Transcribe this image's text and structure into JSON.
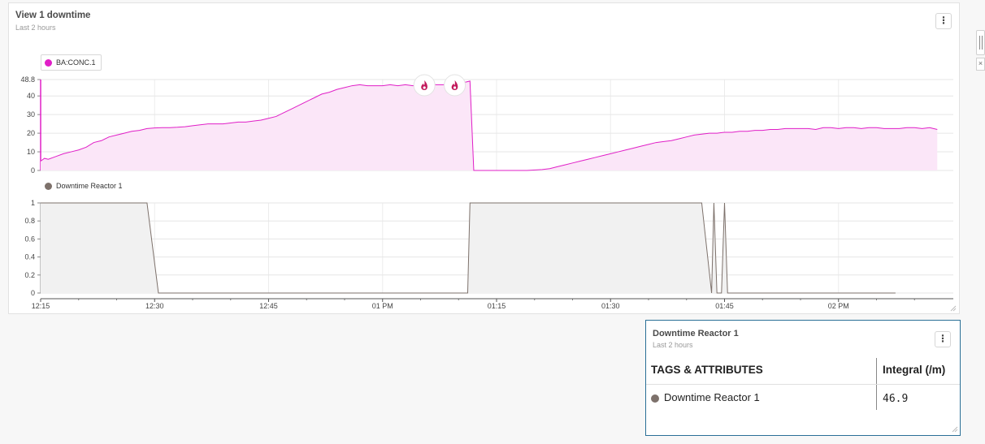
{
  "main_panel": {
    "title": "View 1 downtime",
    "subtitle": "Last 2 hours",
    "menu_glyph": "⋮"
  },
  "table_panel": {
    "title": "Downtime Reactor 1",
    "subtitle": "Last 2 hours",
    "menu_glyph": "⋮",
    "columns": [
      "TAGS & ATTRIBUTES",
      "Integral (/m)"
    ],
    "rows": [
      {
        "name": "Downtime Reactor 1",
        "value": "46.9",
        "color": "#7d716b"
      }
    ]
  },
  "close_glyph": "×",
  "chart_data": [
    {
      "type": "area",
      "series": [
        {
          "name": "BA:CONC.1",
          "color": "#e01fc7"
        }
      ],
      "ylim": [
        0,
        48.8
      ],
      "y_ticks": [
        "0",
        "10",
        "20",
        "30",
        "40",
        "48.8"
      ],
      "x_ticks": [
        "12:15",
        "12:30",
        "12:45",
        "01 PM",
        "01:15",
        "01:30",
        "01:45",
        "02 PM"
      ],
      "x_tick_minutes": [
        0,
        15,
        30,
        45,
        60,
        75,
        90,
        105
      ],
      "points": [
        [
          0,
          5
        ],
        [
          0.5,
          6.5
        ],
        [
          1,
          6
        ],
        [
          2,
          7.5
        ],
        [
          3,
          9
        ],
        [
          4,
          10
        ],
        [
          5,
          11
        ],
        [
          6,
          12.5
        ],
        [
          7,
          15
        ],
        [
          8,
          16
        ],
        [
          9,
          18
        ],
        [
          10,
          19
        ],
        [
          11,
          20
        ],
        [
          12,
          21
        ],
        [
          13,
          21.5
        ],
        [
          14,
          22.5
        ],
        [
          15,
          22.8
        ],
        [
          16,
          23
        ],
        [
          17,
          23
        ],
        [
          18,
          23.2
        ],
        [
          19,
          23.5
        ],
        [
          20,
          24
        ],
        [
          21,
          24.5
        ],
        [
          22,
          25
        ],
        [
          23,
          25
        ],
        [
          24,
          25
        ],
        [
          25,
          25.5
        ],
        [
          26,
          26
        ],
        [
          27,
          26
        ],
        [
          28,
          26.5
        ],
        [
          29,
          27
        ],
        [
          30,
          28
        ],
        [
          31,
          29
        ],
        [
          32,
          31
        ],
        [
          33,
          33
        ],
        [
          34,
          35
        ],
        [
          35,
          37
        ],
        [
          36,
          39
        ],
        [
          37,
          41
        ],
        [
          38,
          42
        ],
        [
          39,
          43.5
        ],
        [
          40,
          44.5
        ],
        [
          41,
          45.5
        ],
        [
          42,
          46
        ],
        [
          43,
          45.5
        ],
        [
          44,
          45.5
        ],
        [
          45,
          45.5
        ],
        [
          46,
          46
        ],
        [
          47,
          45.5
        ],
        [
          48,
          46
        ],
        [
          49,
          45.5
        ],
        [
          50,
          46
        ],
        [
          51,
          46.5
        ],
        [
          52,
          46
        ],
        [
          53,
          46
        ],
        [
          54,
          47
        ],
        [
          55,
          47
        ],
        [
          56,
          47.5
        ],
        [
          56.5,
          48
        ],
        [
          57,
          0
        ],
        [
          62,
          0
        ],
        [
          64,
          0
        ],
        [
          66,
          0.5
        ],
        [
          67,
          1
        ],
        [
          68,
          2
        ],
        [
          69,
          3
        ],
        [
          70,
          4
        ],
        [
          71,
          5
        ],
        [
          72,
          6
        ],
        [
          73,
          7
        ],
        [
          74,
          8
        ],
        [
          75,
          9
        ],
        [
          76,
          10
        ],
        [
          77,
          11
        ],
        [
          78,
          12
        ],
        [
          79,
          13
        ],
        [
          80,
          14
        ],
        [
          81,
          15
        ],
        [
          82,
          15.5
        ],
        [
          83,
          16
        ],
        [
          84,
          17
        ],
        [
          85,
          18
        ],
        [
          86,
          19
        ],
        [
          87,
          19.5
        ],
        [
          88,
          20
        ],
        [
          89,
          20
        ],
        [
          90,
          20.5
        ],
        [
          91,
          20.5
        ],
        [
          92,
          21
        ],
        [
          93,
          21
        ],
        [
          94,
          21.5
        ],
        [
          95,
          21.5
        ],
        [
          96,
          22
        ],
        [
          97,
          22
        ],
        [
          98,
          22.5
        ],
        [
          99,
          22.5
        ],
        [
          100,
          22.5
        ],
        [
          101,
          22.5
        ],
        [
          102,
          22
        ],
        [
          103,
          23
        ],
        [
          104,
          23
        ],
        [
          105,
          22.5
        ],
        [
          106,
          23
        ],
        [
          107,
          23
        ],
        [
          108,
          22.5
        ],
        [
          109,
          23
        ],
        [
          110,
          23
        ],
        [
          111,
          22.5
        ],
        [
          112,
          22.5
        ],
        [
          113,
          22.5
        ],
        [
          114,
          23
        ],
        [
          115,
          23
        ],
        [
          116,
          22.5
        ],
        [
          117,
          23
        ],
        [
          118,
          22
        ]
      ],
      "markers": [
        {
          "x_minute": 50.5,
          "icon": "flame-icon"
        },
        {
          "x_minute": 54.5,
          "icon": "flame-icon"
        }
      ],
      "grid": true
    },
    {
      "type": "area",
      "series": [
        {
          "name": "Downtime Reactor 1",
          "color": "#7d716b"
        }
      ],
      "ylim": [
        0,
        1
      ],
      "y_ticks": [
        "0",
        "0.2",
        "0.4",
        "0.6",
        "0.8",
        "1"
      ],
      "points": [
        [
          0,
          1
        ],
        [
          14,
          1
        ],
        [
          15.5,
          0
        ],
        [
          56.2,
          0
        ],
        [
          56.5,
          1
        ],
        [
          87,
          1
        ],
        [
          88.3,
          0
        ],
        [
          88.6,
          1
        ],
        [
          89,
          0
        ],
        [
          89.6,
          0
        ],
        [
          90,
          1
        ],
        [
          90.4,
          0
        ],
        [
          112.5,
          0
        ]
      ],
      "grid": true
    }
  ]
}
